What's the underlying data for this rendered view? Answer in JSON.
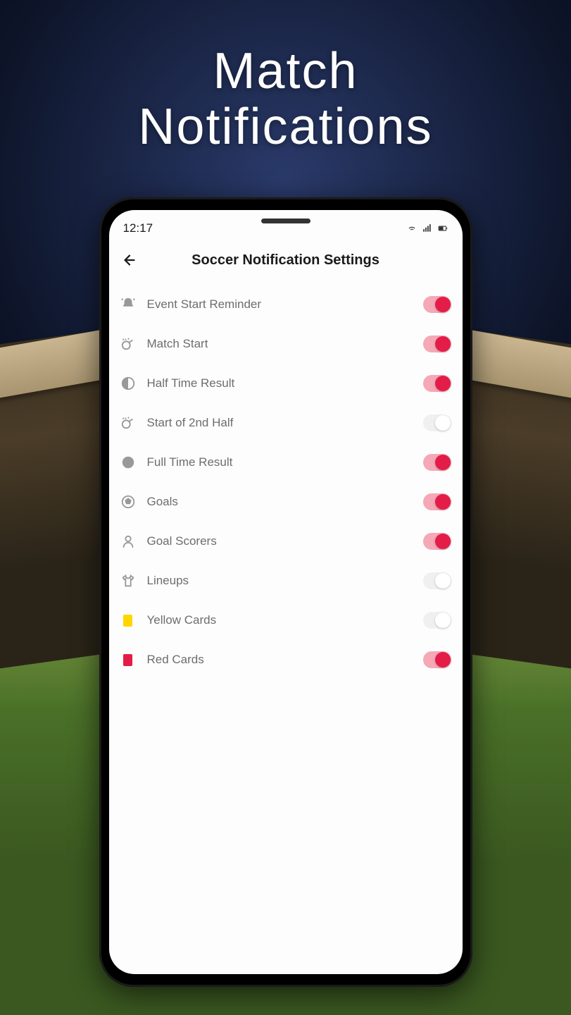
{
  "promo": {
    "headline_line1": "Match",
    "headline_line2": "Notifications"
  },
  "statusbar": {
    "time": "12:17"
  },
  "appbar": {
    "title": "Soccer Notification Settings"
  },
  "settings": [
    {
      "id": "event-start-reminder",
      "icon": "bell-ring",
      "label": "Event Start Reminder",
      "on": true
    },
    {
      "id": "match-start",
      "icon": "whistle",
      "label": "Match Start",
      "on": true
    },
    {
      "id": "half-time-result",
      "icon": "half-circle",
      "label": "Half Time Result",
      "on": true
    },
    {
      "id": "start-2nd-half",
      "icon": "whistle",
      "label": "Start of 2nd Half",
      "on": false
    },
    {
      "id": "full-time-result",
      "icon": "full-circle",
      "label": "Full Time Result",
      "on": true
    },
    {
      "id": "goals",
      "icon": "soccer-ball",
      "label": "Goals",
      "on": true
    },
    {
      "id": "goal-scorers",
      "icon": "person",
      "label": "Goal Scorers",
      "on": true
    },
    {
      "id": "lineups",
      "icon": "jersey",
      "label": "Lineups",
      "on": false
    },
    {
      "id": "yellow-cards",
      "icon": "yellow-card",
      "label": "Yellow Cards",
      "on": false
    },
    {
      "id": "red-cards",
      "icon": "red-card",
      "label": "Red Cards",
      "on": true
    }
  ]
}
